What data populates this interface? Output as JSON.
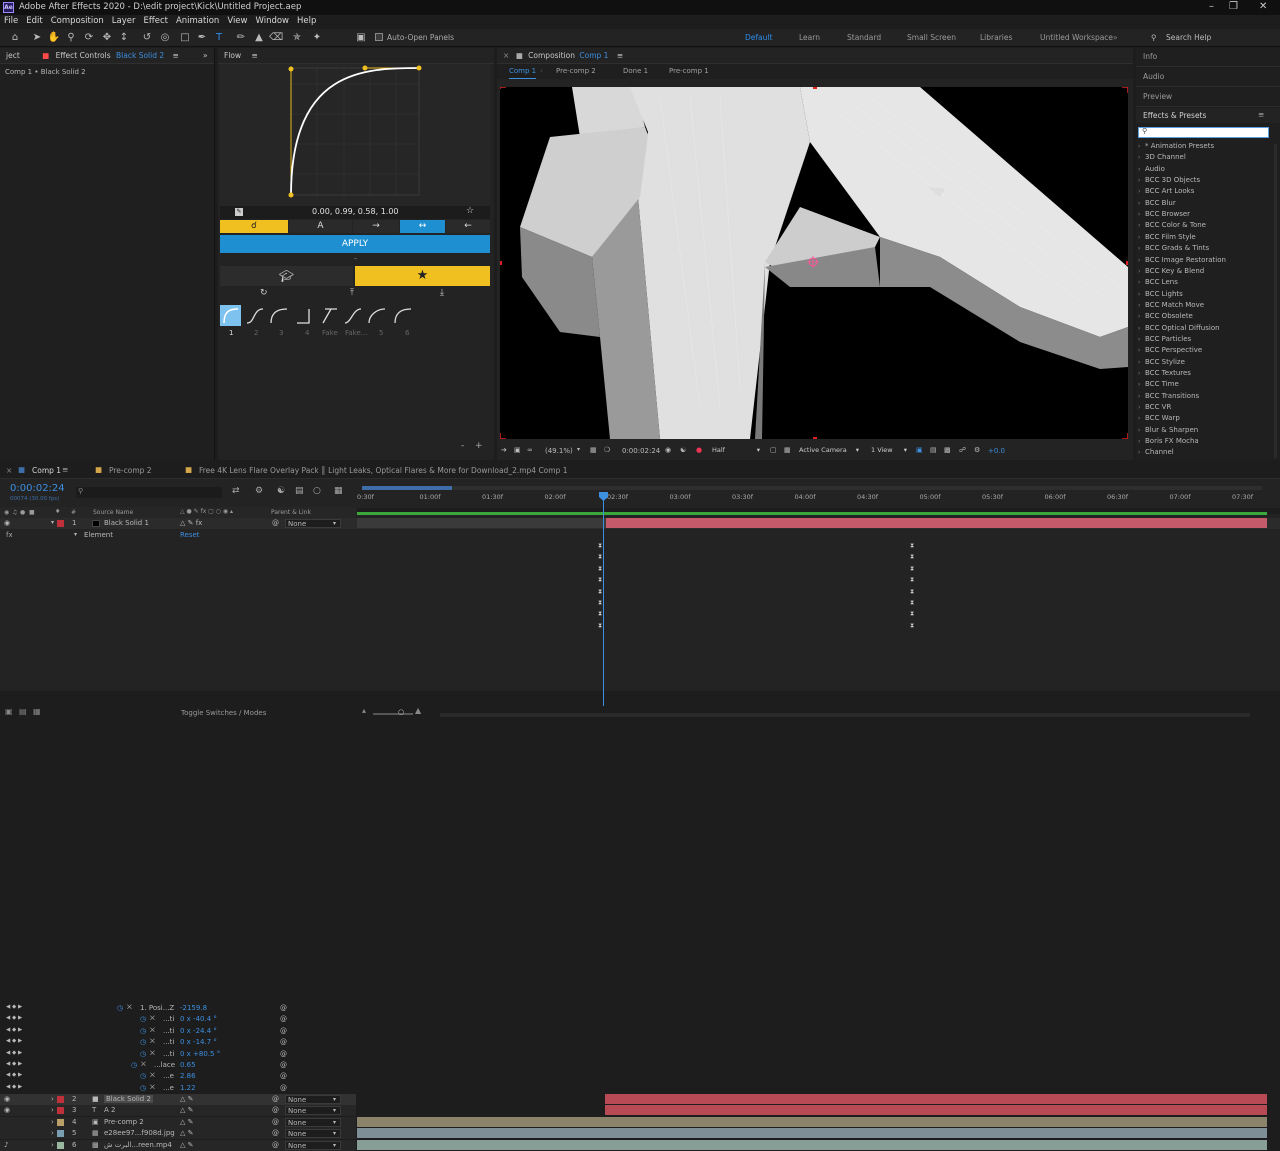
{
  "title_bar": {
    "logo": "Ae",
    "title": "Adobe After Effects 2020 - D:\\edit project\\Kick\\Untitled Project.aep"
  },
  "menu": [
    "File",
    "Edit",
    "Composition",
    "Layer",
    "Effect",
    "Animation",
    "View",
    "Window",
    "Help"
  ],
  "toolbar": {
    "auto_open": "Auto-Open Panels",
    "workspaces": [
      "Default",
      "Learn",
      "Standard",
      "Small Screen",
      "Libraries",
      "Untitled Workspace"
    ],
    "search_help": "Search Help"
  },
  "left_panel": {
    "tab_project": "ject",
    "tab_effect_controls": "Effect Controls",
    "layer_name": "Black Solid 2",
    "subtitle": "Comp 1 • Black Solid 2"
  },
  "flow": {
    "title": "Flow",
    "values": "0.00, 0.99, 0.58, 1.00",
    "apply": "APPLY",
    "preset_labels": [
      "1",
      "2",
      "3",
      "4",
      "Fake",
      "Fake...",
      "5",
      "6"
    ]
  },
  "composition": {
    "title": "Composition",
    "comp_name": "Comp 1",
    "breadcrumbs": [
      "Comp 1",
      "Pre-comp 2",
      "Done 1",
      "Pre-comp 1"
    ],
    "zoom": "(49.1%)",
    "timecode": "0:00:02:24",
    "resolution": "Half",
    "camera": "Active Camera",
    "view": "1 View",
    "exposure": "+0.0"
  },
  "right_panel": {
    "info": "Info",
    "audio": "Audio",
    "preview": "Preview",
    "effects_presets": "Effects & Presets",
    "items": [
      "* Animation Presets",
      "3D Channel",
      "Audio",
      "BCC 3D Objects",
      "BCC Art Looks",
      "BCC Blur",
      "BCC Browser",
      "BCC Color & Tone",
      "BCC Film Style",
      "BCC Grads & Tints",
      "BCC Image Restoration",
      "BCC Key & Blend",
      "BCC Lens",
      "BCC Lights",
      "BCC Match Move",
      "BCC Obsolete",
      "BCC Optical Diffusion",
      "BCC Particles",
      "BCC Perspective",
      "BCC Stylize",
      "BCC Textures",
      "BCC Time",
      "BCC Transitions",
      "BCC VR",
      "BCC Warp",
      "Blur & Sharpen",
      "Boris FX Mocha",
      "Channel"
    ]
  },
  "timeline": {
    "tabs": [
      "Comp 1",
      "Pre-comp 2",
      "Free 4K Lens Flare Overlay Pack ║ Light Leaks, Optical Flares & More for Download_2.mp4 Comp 1"
    ],
    "timecode": "0:00:02:24",
    "fps": "00074 (30.00 fps)",
    "col_source": "Source Name",
    "col_parent": "Parent & Link",
    "col_num": "#",
    "ruler": [
      "0:30f",
      "01:00f",
      "01:30f",
      "02:00f",
      "02:30f",
      "03:00f",
      "03:30f",
      "04:00f",
      "04:30f",
      "05:00f",
      "05:30f",
      "06:00f",
      "06:30f",
      "07:00f",
      "07:30f"
    ],
    "layer1": {
      "num": "1",
      "name": "Black Solid 1",
      "parent": "None"
    },
    "element": "Element",
    "reset": "Reset",
    "props": [
      {
        "name": "1. Posi...Z",
        "value": "-2159.8"
      },
      {
        "name": "...ti",
        "value": "0 x -40.4 °"
      },
      {
        "name": "...ti",
        "value": "0 x -24.4 °"
      },
      {
        "name": "...ti",
        "value": "0 x -14.7 °"
      },
      {
        "name": "...ti",
        "value": "0 x +80.5 °"
      },
      {
        "name": "...lace",
        "value": "0.65"
      },
      {
        "name": "...e",
        "value": "2.86"
      },
      {
        "name": "...e",
        "value": "1.22"
      }
    ],
    "layers": [
      {
        "num": "2",
        "name": "Black Solid 2",
        "parent": "None"
      },
      {
        "num": "3",
        "name": "A 2",
        "parent": "None"
      },
      {
        "num": "4",
        "name": "Pre-comp 2",
        "parent": "None"
      },
      {
        "num": "5",
        "name": "e28ee97...f908d.jpg",
        "parent": "None"
      },
      {
        "num": "6",
        "name": "البرت ش...reen.mp4",
        "parent": "None"
      }
    ],
    "toggle": "Toggle Switches / Modes"
  }
}
